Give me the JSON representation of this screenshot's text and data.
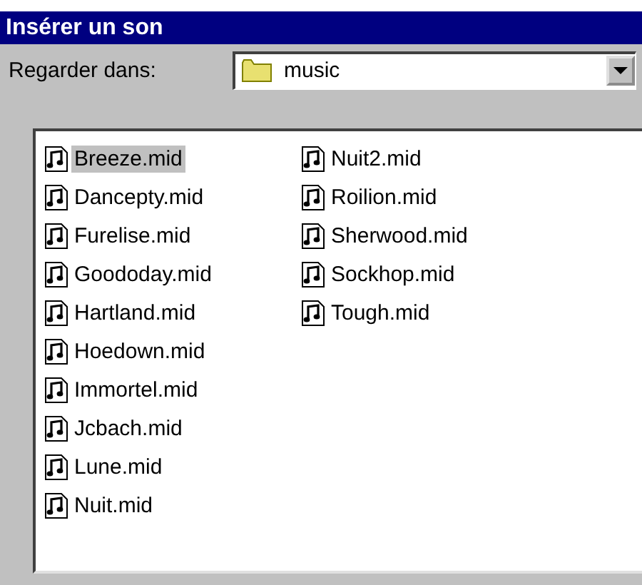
{
  "window": {
    "title": "Insérer un son"
  },
  "look_in": {
    "label": "Regarder dans:",
    "value": "music"
  },
  "files": [
    {
      "name": "Breeze.mid",
      "selected": true
    },
    {
      "name": "Dancepty.mid",
      "selected": false
    },
    {
      "name": "Furelise.mid",
      "selected": false
    },
    {
      "name": "Goododay.mid",
      "selected": false
    },
    {
      "name": "Hartland.mid",
      "selected": false
    },
    {
      "name": "Hoedown.mid",
      "selected": false
    },
    {
      "name": "Immortel.mid",
      "selected": false
    },
    {
      "name": "Jcbach.mid",
      "selected": false
    },
    {
      "name": "Lune.mid",
      "selected": false
    },
    {
      "name": "Nuit.mid",
      "selected": false
    },
    {
      "name": "Nuit2.mid",
      "selected": false
    },
    {
      "name": "Roilion.mid",
      "selected": false
    },
    {
      "name": "Sherwood.mid",
      "selected": false
    },
    {
      "name": "Sockhop.mid",
      "selected": false
    },
    {
      "name": "Tough.mid",
      "selected": false
    }
  ]
}
